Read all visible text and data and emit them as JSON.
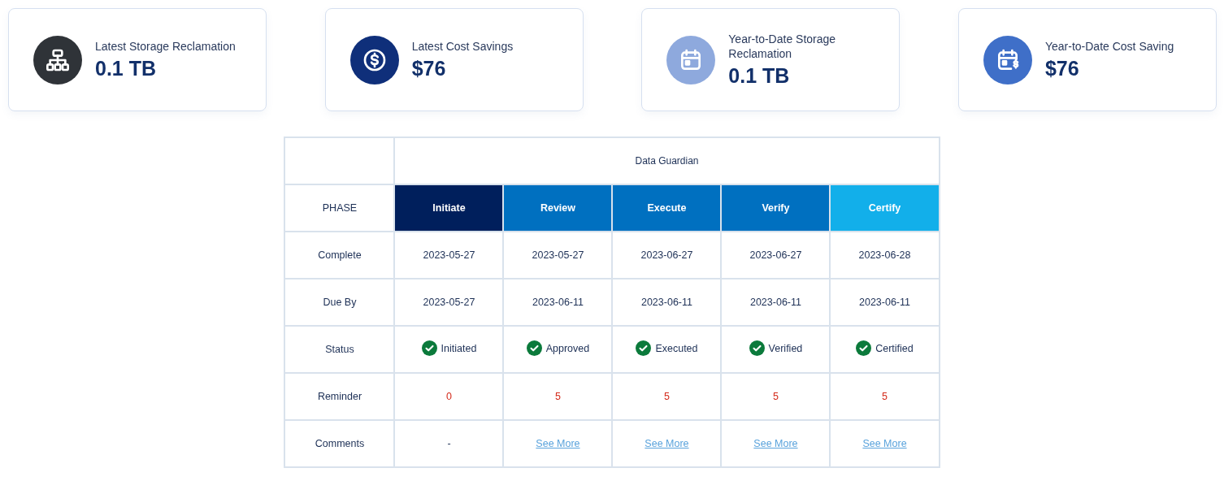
{
  "cards": [
    {
      "label": "Latest Storage Reclamation",
      "value": "0.1 TB",
      "kind": "hierarchy",
      "color": "#2f3338"
    },
    {
      "label": "Latest Cost Savings",
      "value": "$76",
      "kind": "dollar",
      "color": "#0f2f7a"
    },
    {
      "label": "Year-to-Date Storage Reclamation",
      "value": "0.1 TB",
      "kind": "calendar",
      "color": "#8ea9dd"
    },
    {
      "label": "Year-to-Date Cost Saving",
      "value": "$76",
      "kind": "calendar-dollar",
      "color": "#3f6fc8"
    }
  ],
  "table": {
    "title": "Data Guardian",
    "phase_label": "PHASE",
    "phases": [
      {
        "label": "Initiate",
        "color": "#001f5c"
      },
      {
        "label": "Review",
        "color": "#0070c0"
      },
      {
        "label": "Execute",
        "color": "#0070c0"
      },
      {
        "label": "Verify",
        "color": "#0070c0"
      },
      {
        "label": "Certify",
        "color": "#12afea"
      }
    ],
    "rows": [
      {
        "label": "Complete",
        "kind": "text",
        "cells": [
          {
            "text": "2023-05-27"
          },
          {
            "text": "2023-05-27"
          },
          {
            "text": "2023-06-27"
          },
          {
            "text": "2023-06-27"
          },
          {
            "text": "2023-06-28"
          }
        ]
      },
      {
        "label": "Due By",
        "kind": "text",
        "cells": [
          {
            "text": "2023-05-27"
          },
          {
            "text": "2023-06-11"
          },
          {
            "text": "2023-06-11"
          },
          {
            "text": "2023-06-11"
          },
          {
            "text": "2023-06-11"
          }
        ]
      },
      {
        "label": "Status",
        "kind": "status",
        "cells": [
          {
            "text": "Initiated"
          },
          {
            "text": "Approved"
          },
          {
            "text": "Executed"
          },
          {
            "text": "Verified"
          },
          {
            "text": "Certified"
          }
        ]
      },
      {
        "label": "Reminder",
        "kind": "count",
        "cells": [
          {
            "text": "0"
          },
          {
            "text": "5"
          },
          {
            "text": "5"
          },
          {
            "text": "5"
          },
          {
            "text": "5"
          }
        ]
      },
      {
        "label": "Comments",
        "kind": "comment",
        "cells": [
          {
            "text": "-",
            "kind": "plain"
          },
          {
            "text": "See More",
            "kind": "link"
          },
          {
            "text": "See More",
            "kind": "link"
          },
          {
            "text": "See More",
            "kind": "link"
          },
          {
            "text": "See More",
            "kind": "link"
          }
        ]
      }
    ]
  }
}
